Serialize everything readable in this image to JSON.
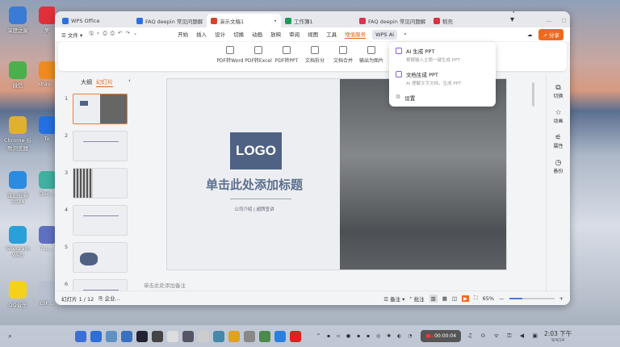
{
  "desktop": {
    "icons": [
      {
        "label": "深度之家",
        "color": "#3a7bd5"
      },
      {
        "label": "微信",
        "color": "#49b04c"
      },
      {
        "label": "Chrome 谷歌浏览器",
        "color": "#e0b030"
      },
      {
        "label": "金山云霸 2024",
        "color": "#2a8be0"
      },
      {
        "label": "Telegram Web",
        "color": "#2aa0da"
      },
      {
        "label": "QQ音乐",
        "color": "#f4d21c"
      }
    ],
    "icons2": [
      {
        "label": "美",
        "color": "#e0303a"
      },
      {
        "label": "drav…",
        "color": "#ef8a20"
      },
      {
        "label": "To",
        "color": "#2470e0"
      },
      {
        "label": "Dee…",
        "color": "#40b0a0"
      },
      {
        "label": "7.1…",
        "color": "#6070c0"
      },
      {
        "label": "GIF…",
        "color": "#b8c0d0"
      }
    ]
  },
  "tabs": [
    {
      "label": "WPS Office",
      "color": "#2b6fe6"
    },
    {
      "label": "FAQ  deepin 常见问题解",
      "color": "#2b6fe6"
    },
    {
      "label": "演示文稿1",
      "color": "#d9412c",
      "active": true
    },
    {
      "label": "工作簿1",
      "color": "#1c9b5a"
    },
    {
      "label": "FAQ  deepin 常见问题解",
      "color": "#e03050"
    },
    {
      "label": "稻壳",
      "color": "#e03040"
    }
  ],
  "toolbar": {
    "file": "文件",
    "menu": [
      "开始",
      "插入",
      "设计",
      "切换",
      "动画",
      "放映",
      "审阅",
      "视图",
      "工具",
      "增值服务"
    ],
    "selected_menu": "增值服务",
    "wps_ai": "WPS AI",
    "share": "分享"
  },
  "ribbon": [
    "PDF转Word",
    "PDF转Excel",
    "PDF转PPT",
    "文档拆分",
    "文档合并",
    "输出为图片"
  ],
  "dropdown": {
    "items": [
      {
        "title": "AI 生成 PPT",
        "sub": "根据输入主题一键生成 PPT"
      },
      {
        "title": "文档生成 PPT",
        "sub": "AI 理解文字文档，生成 PPT"
      }
    ],
    "settings": "设置"
  },
  "panel": {
    "outline_tab": "大纲",
    "slides_tab": "幻灯片",
    "slide_numbers": [
      "1",
      "2",
      "3",
      "4",
      "5",
      "6"
    ]
  },
  "slide": {
    "logo": "LOGO",
    "title": "单击此处添加标题",
    "subtitle": "公司介绍 | 超牌宣讲",
    "notes_placeholder": "单击此处添加备注"
  },
  "right_sidebar": [
    "切换",
    "动画",
    "属性",
    "备份"
  ],
  "status": {
    "slide_count": "幻灯片 1 / 12",
    "theme": "企业...",
    "notes": "备注",
    "comments": "批注",
    "zoom": "65%",
    "zoom_fraction": 0.3
  },
  "taskbar": {
    "recording": "00:00:04",
    "time": "2:03 下午",
    "date": "9/4/24",
    "apps": [
      "#3a6fd8",
      "#2d6fd6",
      "#6090c0",
      "#3a70c0",
      "#223",
      "#444",
      "#ddd",
      "#556",
      "#ccc",
      "#48a",
      "#e0a020",
      "#888",
      "#4a8a4a",
      "#2a80e0",
      "#e02020"
    ]
  }
}
